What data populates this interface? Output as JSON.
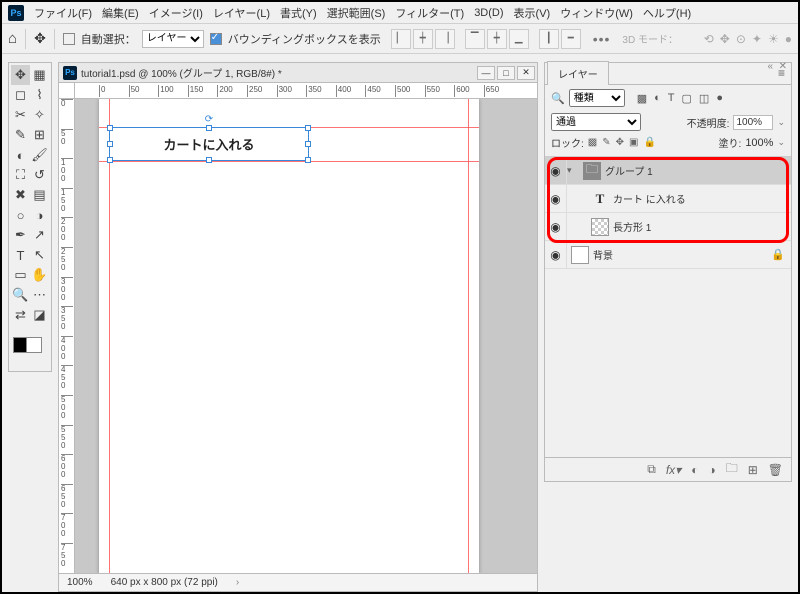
{
  "menubar": {
    "items": [
      "ファイル(F)",
      "編集(E)",
      "イメージ(I)",
      "レイヤー(L)",
      "書式(Y)",
      "選択範囲(S)",
      "フィルター(T)",
      "3D(D)",
      "表示(V)",
      "ウィンドウ(W)",
      "ヘルプ(H)"
    ]
  },
  "optbar": {
    "auto_select": "自動選択：",
    "layer_select": "レイヤー",
    "bounding": "バウンディングボックスを表示",
    "threed": "3D モード："
  },
  "doc": {
    "title": "tutorial1.psd @ 100% (グループ 1, RGB/8#) *",
    "zoom": "100%",
    "dims": "640 px x 800 px (72 ppi)",
    "ruler_top": [
      "0",
      "50",
      "100",
      "150",
      "200",
      "250",
      "300",
      "350",
      "400",
      "450",
      "500",
      "550",
      "600",
      "650"
    ],
    "ruler_left": [
      "0",
      "50",
      "100",
      "150",
      "200",
      "250",
      "300",
      "350",
      "400",
      "450",
      "500",
      "550",
      "600",
      "650",
      "700",
      "750"
    ],
    "canvas_text": "カートに入れる"
  },
  "layers_panel": {
    "tab": "レイヤー",
    "kind": "種類",
    "blend": "通過",
    "opacity_label": "不透明度:",
    "opacity_value": "100%",
    "lock_label": "ロック:",
    "fill_label": "塗り:",
    "fill_value": "100%",
    "rows": [
      {
        "name": "グループ 1",
        "type": "folder",
        "selected": true,
        "indent": 0
      },
      {
        "name": "カート に入れる",
        "type": "text",
        "indent": 1
      },
      {
        "name": "長方形 1",
        "type": "rect",
        "indent": 1
      },
      {
        "name": "背景",
        "type": "bg",
        "locked": true,
        "indent": 0
      }
    ]
  }
}
